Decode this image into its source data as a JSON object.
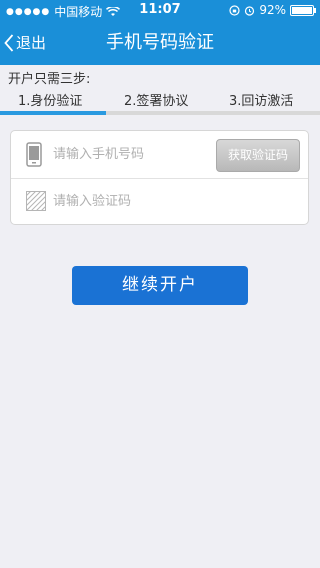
{
  "status_bar": {
    "carrier": "中国移动",
    "time": "11:07",
    "battery": "92%",
    "battery_level": 0.92
  },
  "nav": {
    "back_label": "退出",
    "title": "手机号码验证"
  },
  "steps": {
    "heading": "开户只需三步:",
    "items": [
      "1.身份验证",
      "2.签署协议",
      "3.回访激活"
    ],
    "progress": 0.33
  },
  "form": {
    "phone_placeholder": "请输入手机号码",
    "get_code_label": "获取验证码",
    "code_placeholder": "请输入验证码"
  },
  "submit_label": "继续开户"
}
